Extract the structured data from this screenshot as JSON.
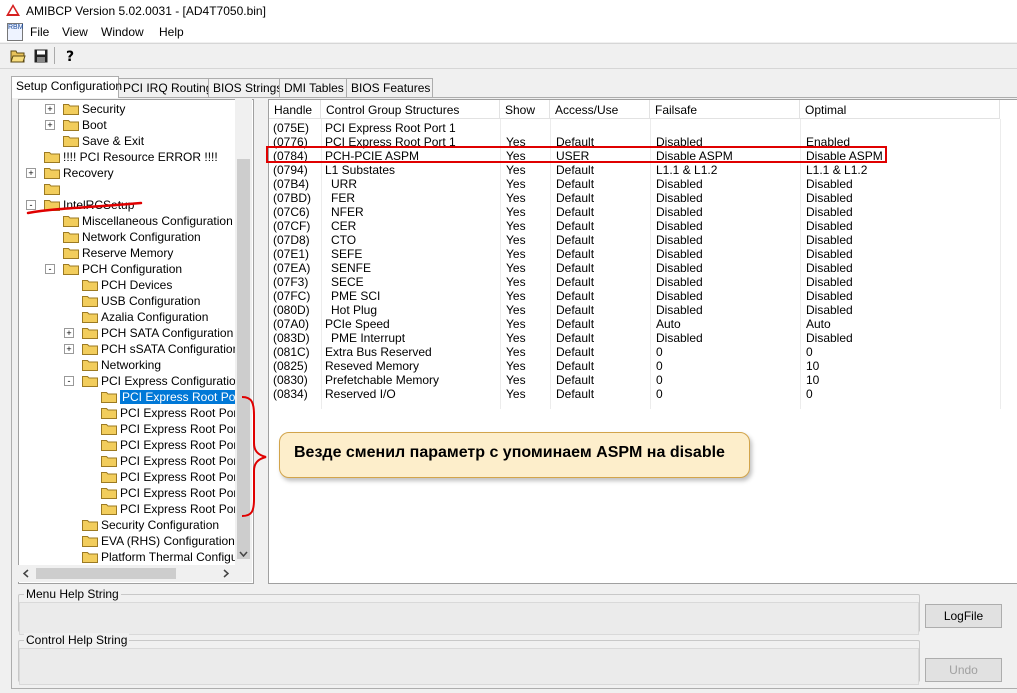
{
  "window": {
    "title": "AMIBCP Version 5.02.0031 - [AD4T7050.bin]",
    "app_icon": "app-icon"
  },
  "menu": {
    "app_icon_label": "RBM",
    "items": [
      "File",
      "View",
      "Window",
      "Help"
    ]
  },
  "toolbar": {
    "buttons": [
      "open-folder-icon",
      "save-icon",
      "help-icon"
    ]
  },
  "tabs": [
    "Setup Configuration",
    "PCI IRQ Routing",
    "BIOS Strings",
    "DMI Tables",
    "BIOS Features"
  ],
  "active_tab": "Setup Configuration",
  "tree": {
    "items": [
      {
        "label": "Security",
        "expander": "+"
      },
      {
        "label": "Boot",
        "expander": "+"
      },
      {
        "label": "Save & Exit",
        "expander": ""
      },
      {
        "label": "!!!! PCI Resource ERROR !!!!",
        "expander": ""
      },
      {
        "label": "Recovery",
        "expander": "+"
      },
      {
        "label": "",
        "expander": ""
      },
      {
        "label": "IntelRCSetup",
        "expander": "-"
      },
      {
        "label": "Miscellaneous Configuration",
        "expander": ""
      },
      {
        "label": "Network Configuration",
        "expander": ""
      },
      {
        "label": "Reserve Memory",
        "expander": ""
      },
      {
        "label": "PCH Configuration",
        "expander": "-"
      },
      {
        "label": "PCH Devices",
        "expander": ""
      },
      {
        "label": "USB Configuration",
        "expander": ""
      },
      {
        "label": "Azalia Configuration",
        "expander": ""
      },
      {
        "label": "PCH SATA Configuration",
        "expander": "+"
      },
      {
        "label": "PCH sSATA Configuration",
        "expander": "+"
      },
      {
        "label": "Networking",
        "expander": ""
      },
      {
        "label": "PCI Express Configuration",
        "expander": "-"
      },
      {
        "label": "PCI Express Root Por",
        "expander": "",
        "selected": true
      },
      {
        "label": "PCI Express Root Por",
        "expander": ""
      },
      {
        "label": "PCI Express Root Por",
        "expander": ""
      },
      {
        "label": "PCI Express Root Por",
        "expander": ""
      },
      {
        "label": "PCI Express Root Por",
        "expander": ""
      },
      {
        "label": "PCI Express Root Por",
        "expander": ""
      },
      {
        "label": "PCI Express Root Por",
        "expander": ""
      },
      {
        "label": "PCI Express Root Por",
        "expander": ""
      },
      {
        "label": "Security Configuration",
        "expander": ""
      },
      {
        "label": "EVA (RHS) Configuration",
        "expander": ""
      },
      {
        "label": "Platform Thermal Configu",
        "expander": ""
      }
    ]
  },
  "grid": {
    "columns": [
      "Handle",
      "Control Group Structures",
      "Show",
      "Access/Use",
      "Failsafe",
      "Optimal"
    ],
    "rows": [
      [
        "(075E)",
        "PCI Express Root Port 1",
        "",
        "",
        "",
        ""
      ],
      [
        "(0776)",
        "PCI Express Root Port 1",
        "Yes",
        "Default",
        "Disabled",
        "Enabled"
      ],
      [
        "(0784)",
        "PCH-PCIE ASPM",
        "Yes",
        "USER",
        "Disable ASPM",
        "Disable ASPM"
      ],
      [
        "(0794)",
        "L1 Substates",
        "Yes",
        "Default",
        "L1.1 & L1.2",
        "L1.1 & L1.2"
      ],
      [
        "(07B4)",
        "URR",
        "Yes",
        "Default",
        "Disabled",
        "Disabled"
      ],
      [
        "(07BD)",
        "FER",
        "Yes",
        "Default",
        "Disabled",
        "Disabled"
      ],
      [
        "(07C6)",
        "NFER",
        "Yes",
        "Default",
        "Disabled",
        "Disabled"
      ],
      [
        "(07CF)",
        "CER",
        "Yes",
        "Default",
        "Disabled",
        "Disabled"
      ],
      [
        "(07D8)",
        "CTO",
        "Yes",
        "Default",
        "Disabled",
        "Disabled"
      ],
      [
        "(07E1)",
        "SEFE",
        "Yes",
        "Default",
        "Disabled",
        "Disabled"
      ],
      [
        "(07EA)",
        "SENFE",
        "Yes",
        "Default",
        "Disabled",
        "Disabled"
      ],
      [
        "(07F3)",
        "SECE",
        "Yes",
        "Default",
        "Disabled",
        "Disabled"
      ],
      [
        "(07FC)",
        "PME SCI",
        "Yes",
        "Default",
        "Disabled",
        "Disabled"
      ],
      [
        "(080D)",
        "Hot Plug",
        "Yes",
        "Default",
        "Disabled",
        "Disabled"
      ],
      [
        "(07A0)",
        "PCIe Speed",
        "Yes",
        "Default",
        "Auto",
        "Auto"
      ],
      [
        "(083D)",
        "PME Interrupt",
        "Yes",
        "Default",
        "Disabled",
        "Disabled"
      ],
      [
        "(081C)",
        "Extra Bus Reserved",
        "Yes",
        "Default",
        "0",
        "0"
      ],
      [
        "(0825)",
        "Reseved Memory",
        "Yes",
        "Default",
        "0",
        "10"
      ],
      [
        "(0830)",
        "Prefetchable Memory",
        "Yes",
        "Default",
        "0",
        "10"
      ],
      [
        "(0834)",
        "Reserved I/O",
        "Yes",
        "Default",
        "0",
        "0"
      ]
    ],
    "highlighted_handle": "(0784)"
  },
  "annotation": {
    "callout_text": "Везде сменил параметр с упоминаем ASPM на disable",
    "color": "#e00000"
  },
  "help": {
    "menu_help_label": "Menu Help String",
    "control_help_label": "Control Help String"
  },
  "buttons": {
    "logfile": "LogFile",
    "undo": "Undo"
  },
  "colors": {
    "selection": "#0078d7",
    "folder": "#f2cd5c",
    "annotation": "#e00000",
    "callout_bg": "#fdeecb"
  }
}
